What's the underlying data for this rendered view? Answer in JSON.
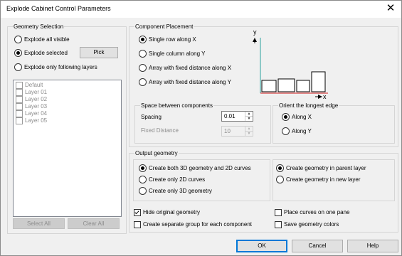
{
  "window": {
    "title": "Explode Cabinet Control Parameters",
    "close_glyph": "✕"
  },
  "geometry_selection": {
    "title": "Geometry Selection",
    "explode_all": "Explode all visible",
    "explode_selected": "Explode selected",
    "pick": "Pick",
    "explode_layers": "Explode only following layers",
    "selected": "explode_selected",
    "layers": [
      "Default",
      "Layer 01",
      "Layer 02",
      "Layer 03",
      "Layer 04",
      "Layer 05"
    ],
    "select_all": "Select All",
    "clear_all": "Clear All"
  },
  "component_placement": {
    "title": "Component Placement",
    "options": [
      "Single row along X",
      "Single column along Y",
      "Array with fixed distance along X",
      "Array with fixed distance along Y"
    ],
    "selected_index": 0,
    "preview": {
      "y_axis": "y",
      "x_axis": "x"
    }
  },
  "space_between": {
    "title": "Space between components",
    "spacing_label": "Spacing",
    "spacing_value": "0.01",
    "fixed_label": "Fixed Distance",
    "fixed_value": "10"
  },
  "orient": {
    "title": "Orient the longest edge",
    "along_x": "Along X",
    "along_y": "Along Y",
    "selected": "along_x"
  },
  "output_geometry": {
    "title": "Output geometry",
    "options": [
      "Create both 3D geometry and 2D curves",
      "Create only 2D curves",
      "Create only 3D geometry"
    ],
    "selected_index": 0,
    "layer_options": [
      "Create geometry in parent layer",
      "Create geometry in new layer"
    ],
    "layer_selected_index": 0
  },
  "checks": {
    "hide_original": {
      "label": "Hide original geometry",
      "checked": true
    },
    "separate_group": {
      "label": "Create separate group for each component",
      "checked": false
    },
    "one_pane": {
      "label": "Place curves on one pane",
      "checked": false
    },
    "save_colors": {
      "label": "Save geometry colors",
      "checked": false
    }
  },
  "buttons": {
    "ok": "OK",
    "cancel": "Cancel",
    "help": "Help"
  },
  "colors": {
    "axis_y": "#2aa29e",
    "axis_x": "#d41c1c",
    "default_button_border": "#0078d7"
  }
}
